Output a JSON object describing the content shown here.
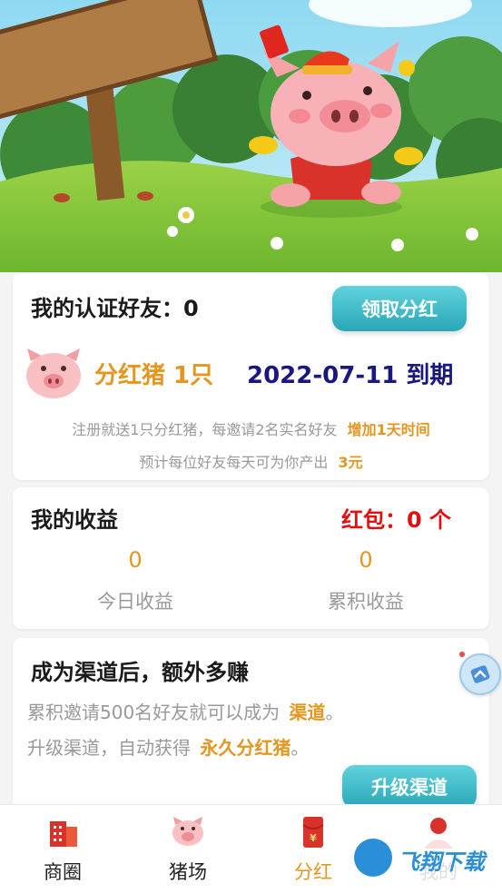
{
  "friends": {
    "label": "我的认证好友：",
    "count": "0",
    "claim_button": "领取分红"
  },
  "pig": {
    "label": "分红猪 1只",
    "expiry": "2022-07-11 到期"
  },
  "notes": {
    "line1_prefix": "注册就送1只分红猪，每邀请2名实名好友",
    "line1_highlight": "增加1天时间",
    "line2_prefix": "预计每位好友每天可为你产出",
    "line2_highlight": "3元"
  },
  "earnings": {
    "title": "我的收益",
    "red_packet": "红包：0 个",
    "today_value": "0",
    "today_label": "今日收益",
    "total_value": "0",
    "total_label": "累积收益"
  },
  "channel": {
    "title": "成为渠道后，额外多赚",
    "line1_prefix": "累积邀请500名好友就可以成为",
    "line1_highlight": "渠道",
    "line1_suffix": "。",
    "line2_prefix": "升级渠道，自动获得",
    "line2_highlight": "永久分红猪",
    "line2_suffix": "。",
    "upgrade_button": "升级渠道"
  },
  "tabs": [
    {
      "label": "商圈",
      "icon": "building-icon"
    },
    {
      "label": "猪场",
      "icon": "pig-icon"
    },
    {
      "label": "分红",
      "icon": "red-packet-icon",
      "active": true
    },
    {
      "label": "我的",
      "icon": "user-icon"
    }
  ],
  "watermark": "飞翔下载",
  "colors": {
    "accent_orange": "#e5961f",
    "navy": "#19187f",
    "red": "#e50e0e",
    "button_teal": "#35b1c1"
  }
}
